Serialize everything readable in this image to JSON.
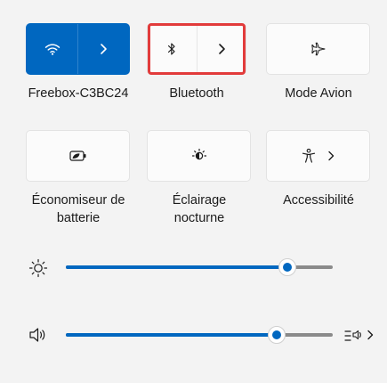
{
  "quick_settings": {
    "tiles": [
      {
        "id": "wifi",
        "label": "Freebox-C3BC24",
        "active": true,
        "split": true,
        "icon": "wifi-icon",
        "chevron": "chevron-right-icon"
      },
      {
        "id": "bluetooth",
        "label": "Bluetooth",
        "active": false,
        "split": true,
        "icon": "bluetooth-icon",
        "chevron": "chevron-right-icon",
        "highlighted": true
      },
      {
        "id": "airplane",
        "label": "Mode Avion",
        "active": false,
        "split": false,
        "icon": "airplane-icon"
      },
      {
        "id": "battery_saver",
        "label_line1": "Économiseur de",
        "label_line2": "batterie",
        "active": false,
        "split": false,
        "icon": "battery-saver-icon"
      },
      {
        "id": "night_light",
        "label_line1": "Éclairage",
        "label_line2": "nocturne",
        "active": false,
        "split": false,
        "icon": "night-light-icon"
      },
      {
        "id": "accessibility",
        "label": "Accessibilité",
        "active": false,
        "split": false,
        "icon": "accessibility-icon",
        "chevron": "chevron-right-icon"
      }
    ]
  },
  "sliders": {
    "brightness": {
      "icon": "brightness-icon",
      "level": 0.83
    },
    "volume": {
      "icon": "speaker-icon",
      "level": 0.79,
      "extra_icon": "audio-output-icon",
      "extra_chevron": "chevron-right-icon"
    }
  },
  "colors": {
    "accent": "#0067c0",
    "highlight_border": "#e23b3b",
    "tile_bg": "#fbfbfb",
    "panel_bg": "#f3f3f3"
  }
}
